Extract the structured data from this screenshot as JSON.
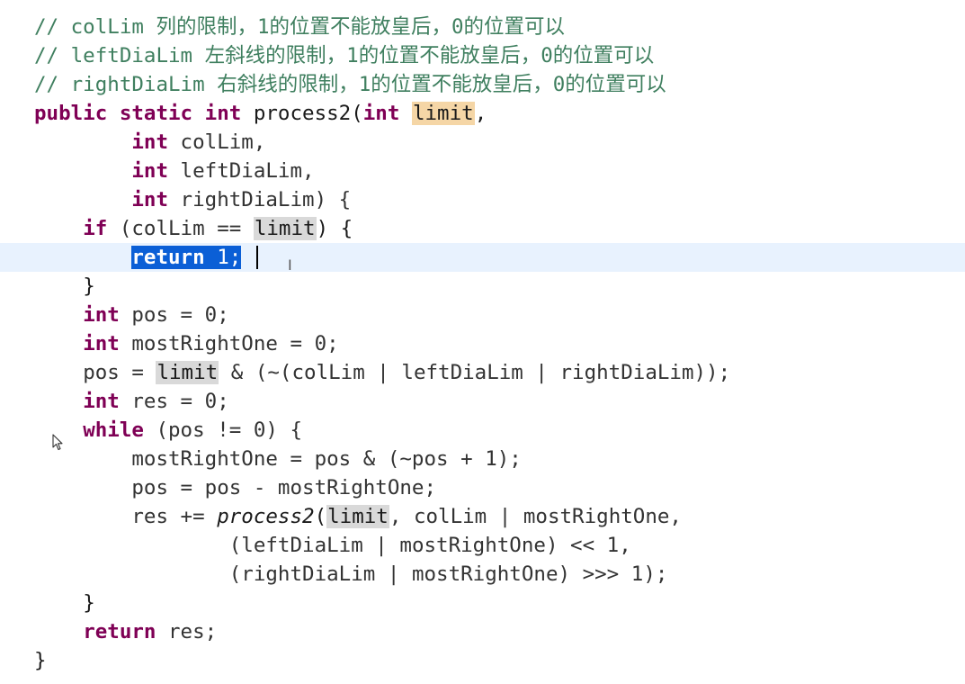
{
  "code_lines": [
    {
      "indent": "",
      "text": "// colLim 列的限制，1的位置不能放皇后，0的位置可以"
    },
    {
      "indent": "",
      "text": "// leftDiaLim 左斜线的限制，1的位置不能放皇后，0的位置可以"
    },
    {
      "indent": "",
      "text": "// rightDiaLim 右斜线的限制，1的位置不能放皇后，0的位置可以"
    },
    {
      "kw1": "public static int",
      "name": " process2(",
      "kw2": "int",
      "sp": " ",
      "param": "limit",
      "tail": ","
    },
    {
      "indent": "        ",
      "kw": "int",
      "rest": " colLim,"
    },
    {
      "indent": "        ",
      "kw": "int",
      "rest": " leftDiaLim,"
    },
    {
      "indent": "        ",
      "kw": "int",
      "rest": " rightDiaLim) {"
    },
    {
      "indent": "    ",
      "kw": "if",
      "pre": " (colLim == ",
      "hl": "limit",
      "post": ") {"
    },
    {
      "indent": "        ",
      "kw": "return",
      "rest": " 1;"
    },
    {
      "indent": "    ",
      "text": "}"
    },
    {
      "indent": "    ",
      "kw": "int",
      "rest": " pos = 0;"
    },
    {
      "indent": "    ",
      "kw": "int",
      "rest": " mostRightOne = 0;"
    },
    {
      "indent": "    ",
      "pre": "pos = ",
      "hl": "limit",
      "post": " & (~(colLim | leftDiaLim | rightDiaLim));"
    },
    {
      "indent": "    ",
      "kw": "int",
      "rest": " res = 0;"
    },
    {
      "indent": "    ",
      "kw": "while",
      "rest": " (pos != 0) {"
    },
    {
      "indent": "        ",
      "text": "mostRightOne = pos & (~pos + 1);"
    },
    {
      "indent": "        ",
      "text": "pos = pos - mostRightOne;"
    },
    {
      "indent": "        ",
      "pre": "res += ",
      "call": "process2",
      "mid": "(",
      "hl": "limit",
      "post": ", colLim | mostRightOne,"
    },
    {
      "indent": "                ",
      "text": "(leftDiaLim | mostRightOne) << 1,"
    },
    {
      "indent": "                ",
      "text": "(rightDiaLim | mostRightOne) >>> 1);"
    },
    {
      "indent": "    ",
      "text": "}"
    },
    {
      "indent": "    ",
      "kw": "return",
      "rest": " res;"
    },
    {
      "indent": "",
      "text": "}"
    }
  ],
  "editor": {
    "current_line": 9,
    "selected_text": "return 1;",
    "pointer_cursor": "arrow-pointer-icon",
    "text_cursor": "i-beam-icon",
    "ibeam_glyph": "I",
    "colors": {
      "keyword": "#7f0055",
      "comment": "#3f7f5f",
      "selection": "#0b5fd6",
      "current_line": "#e8f2fe",
      "definition_highlight": "#f5d6a6",
      "occurrence_highlight": "#d9d9d9"
    }
  }
}
